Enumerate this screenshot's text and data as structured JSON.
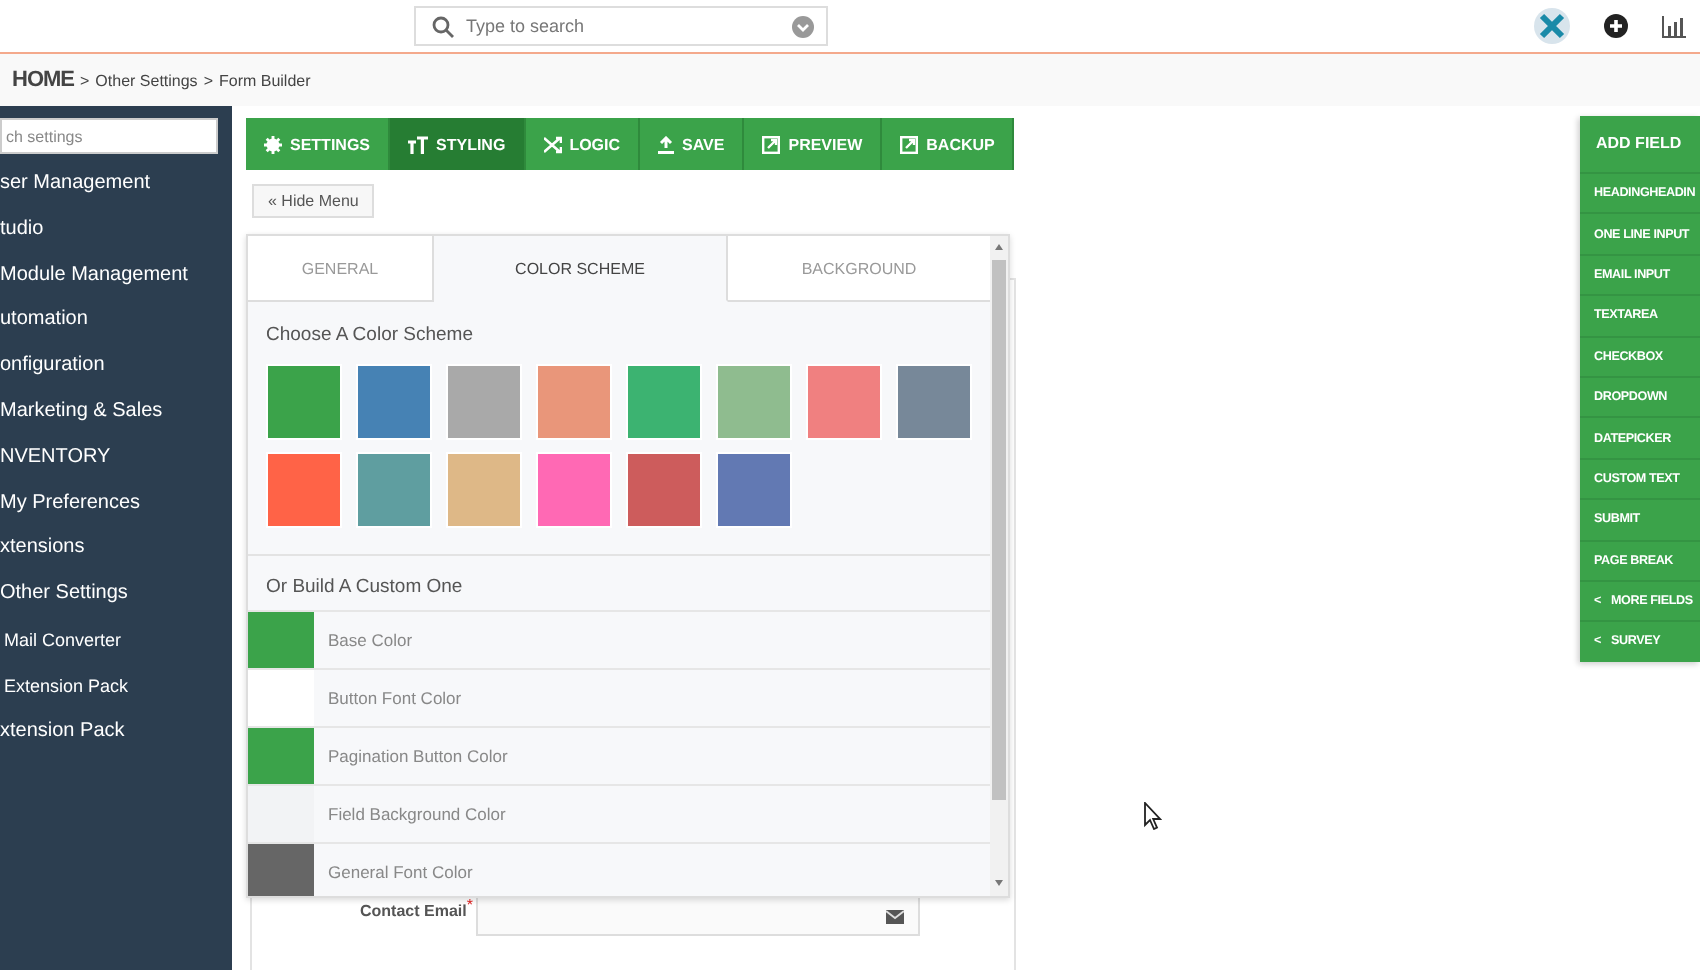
{
  "search": {
    "placeholder": "Type to search"
  },
  "breadcrumb": [
    {
      "label": "HOME",
      "kind": "home"
    },
    {
      "label": "Other Settings",
      "kind": "link"
    },
    {
      "label": "Form Builder",
      "kind": "current"
    }
  ],
  "breadcrumb_separator": ">",
  "sidebar": {
    "search_placeholder": "ch settings",
    "items": [
      {
        "label": "ser Management",
        "kind": "top"
      },
      {
        "label": "tudio",
        "kind": "top"
      },
      {
        "label": "Module Management",
        "kind": "top"
      },
      {
        "label": "utomation",
        "kind": "top"
      },
      {
        "label": "onfiguration",
        "kind": "top"
      },
      {
        "label": "Marketing & Sales",
        "kind": "top"
      },
      {
        "label": "NVENTORY",
        "kind": "top"
      },
      {
        "label": "My Preferences",
        "kind": "top"
      },
      {
        "label": "xtensions",
        "kind": "top"
      },
      {
        "label": "Other Settings",
        "kind": "top"
      },
      {
        "label": "Mail Converter",
        "kind": "sub"
      },
      {
        "label": "Extension Pack",
        "kind": "sub"
      },
      {
        "label": "xtension Pack",
        "kind": "top"
      }
    ]
  },
  "toolbar": [
    {
      "label": "SETTINGS",
      "selected": false
    },
    {
      "label": "STYLING",
      "selected": true
    },
    {
      "label": "LOGIC",
      "selected": false
    },
    {
      "label": "SAVE",
      "selected": false
    },
    {
      "label": "PREVIEW",
      "selected": false
    },
    {
      "label": "BACKUP",
      "selected": false
    }
  ],
  "hide_menu": "« Hide Menu",
  "tabs": [
    {
      "label": "GENERAL",
      "selected": false
    },
    {
      "label": "COLOR SCHEME",
      "selected": true
    },
    {
      "label": "BACKGROUND",
      "selected": false
    }
  ],
  "scheme_heading": "Choose A Color Scheme",
  "schemes": [
    {
      "color": "#3ba34a"
    },
    {
      "color": "#4682b4"
    },
    {
      "color": "#a9a9a9"
    },
    {
      "color": "#e9967a"
    },
    {
      "color": "#3cb371"
    },
    {
      "color": "#8fbc8f"
    },
    {
      "color": "#f08080"
    },
    {
      "color": "#778899"
    },
    {
      "color": "#ff6347"
    },
    {
      "color": "#5f9ea0"
    },
    {
      "color": "#deb887"
    },
    {
      "color": "#ff69b4"
    },
    {
      "color": "#cd5c5c"
    },
    {
      "color": "#6279b3"
    }
  ],
  "custom_heading": "Or Build A Custom One",
  "custom_colors": [
    {
      "label": "Base Color",
      "color": "#3ba34a"
    },
    {
      "label": "Button Font Color",
      "color": "#ffffff"
    },
    {
      "label": "Pagination Button Color",
      "color": "#3ba34a"
    },
    {
      "label": "Field Background Color",
      "color": "#f2f3f5"
    },
    {
      "label": "General Font Color",
      "color": "#666666"
    }
  ],
  "form_field": {
    "label": "Contact Email",
    "required_mark": "*"
  },
  "add_field": {
    "title": "ADD FIELD",
    "items": [
      {
        "label": "HEADINGHEADIN"
      },
      {
        "label": "ONE LINE INPUT"
      },
      {
        "label": "EMAIL INPUT"
      },
      {
        "label": "TEXTAREA"
      },
      {
        "label": "CHECKBOX"
      },
      {
        "label": "DROPDOWN"
      },
      {
        "label": "DATEPICKER"
      },
      {
        "label": "CUSTOM TEXT"
      },
      {
        "label": "SUBMIT"
      },
      {
        "label": "PAGE BREAK"
      },
      {
        "label": "MORE FIELDS",
        "icon": "<"
      },
      {
        "label": "SURVEY",
        "icon": "<"
      }
    ]
  }
}
